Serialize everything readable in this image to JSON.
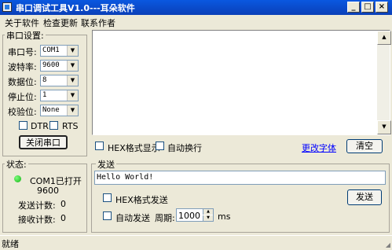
{
  "window": {
    "title": "串口调试工具V1.0---耳朵软件",
    "min_glyph": "_",
    "max_glyph": "□",
    "close_glyph": "×"
  },
  "menu": [
    "关于软件",
    "检查更新",
    "联系作者"
  ],
  "serial_settings": {
    "title": "串口设置:",
    "port_label": "串口号:",
    "port_value": "COM1",
    "baud_label": "波特率:",
    "baud_value": "9600",
    "databits_label": "数据位:",
    "databits_value": "8",
    "stopbits_label": "停止位:",
    "stopbits_value": "1",
    "parity_label": "校验位:",
    "parity_value": "None",
    "dtr_label": "DTR",
    "rts_label": "RTS",
    "close_port_button": "关闭串口"
  },
  "receive": {
    "hex_display_label": "HEX格式显示",
    "auto_wrap_label": "自动换行",
    "change_font_link": "更改字体",
    "clear_button": "清空"
  },
  "status": {
    "title": "状态:",
    "port_state": "COM1已打开",
    "baud": "9600",
    "sent_count_label": "发送计数:",
    "sent_count_value": "0",
    "recv_count_label": "接收计数:",
    "recv_count_value": "0"
  },
  "send": {
    "title": "发送",
    "text": "Hello World!",
    "hex_send_label": "HEX格式发送",
    "send_button": "发送",
    "auto_send_label": "自动发送",
    "period_label": "周期:",
    "period_value": "1000",
    "period_unit": "ms"
  },
  "statusbar": {
    "text": "就绪"
  }
}
